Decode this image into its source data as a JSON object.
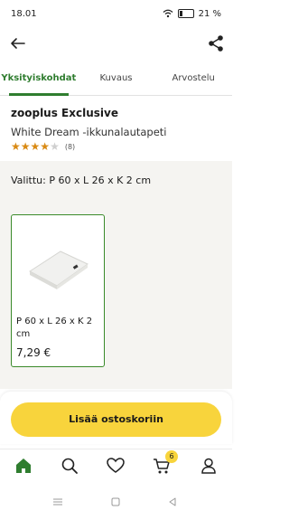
{
  "status_bar": {
    "time": "18.01",
    "battery": "21 %"
  },
  "tabs": [
    {
      "label": "Yksityiskohdat"
    },
    {
      "label": "Kuvaus"
    },
    {
      "label": "Arvostelu"
    }
  ],
  "product": {
    "brand": "zooplus Exclusive",
    "name": "White Dream -ikkunalautapeti",
    "rating": 4,
    "rating_max": 5,
    "review_count": "(8)"
  },
  "selection": {
    "label": "Valittu: P 60 x L 26 x K 2 cm"
  },
  "variant": {
    "size": "P 60 x L 26 x K 2 cm",
    "price": "7,29 €"
  },
  "actions": {
    "add_to_cart": "Lisää ostoskoriin"
  },
  "nav": {
    "items": [
      "home-icon",
      "search-icon",
      "heart-icon",
      "cart-icon",
      "profile-icon"
    ],
    "cart_badge": "6"
  },
  "colors": {
    "accent_green": "#2f7d2f",
    "cta_yellow": "#f8d43c",
    "star": "#d98a14"
  }
}
